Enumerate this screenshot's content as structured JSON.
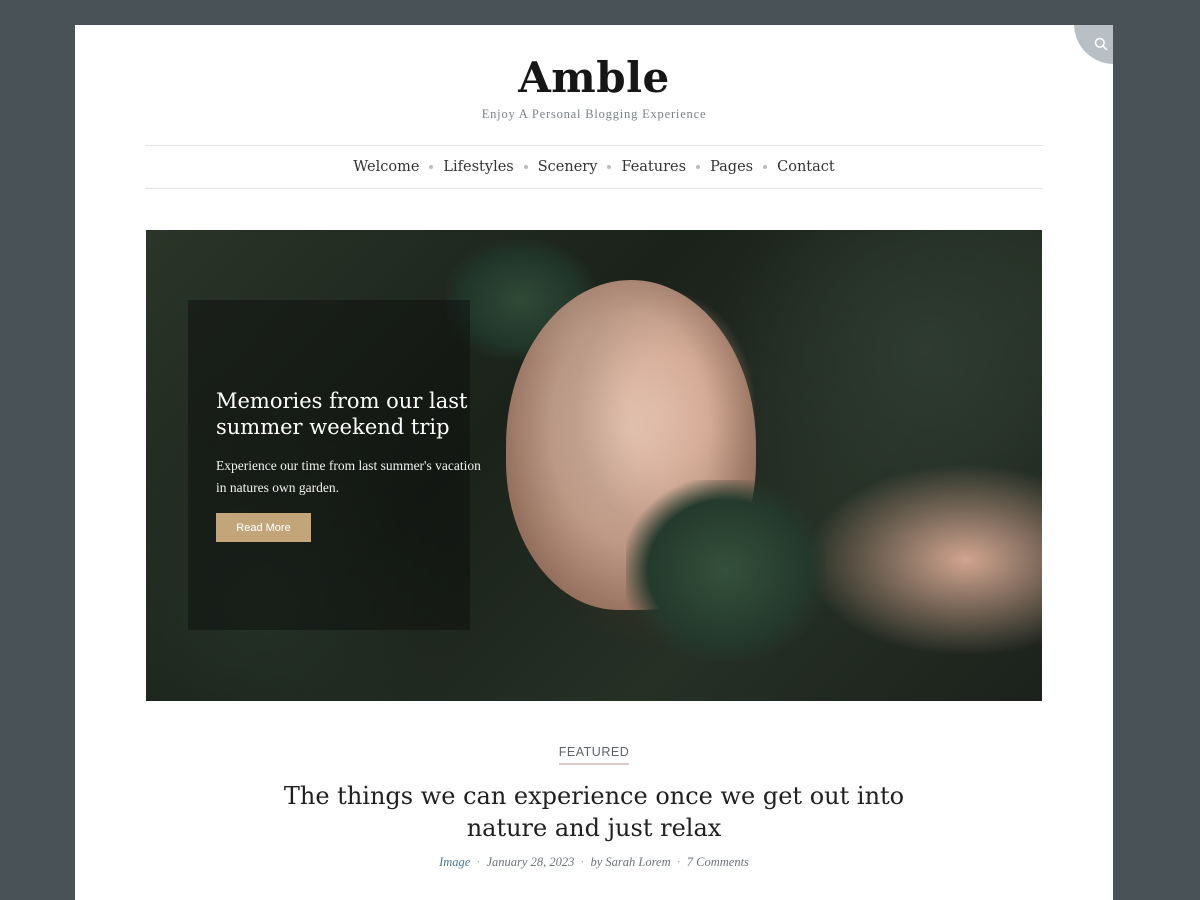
{
  "header": {
    "site_title": "Amble",
    "tagline": "Enjoy A Personal Blogging Experience"
  },
  "search": {
    "icon": "search-icon",
    "color": "#b8c0c6"
  },
  "nav": {
    "items": [
      "Welcome",
      "Lifestyles",
      "Scenery",
      "Features",
      "Pages",
      "Contact"
    ]
  },
  "hero": {
    "title": "Memories from our last summer weekend trip",
    "text": "Experience our time from last summer's vacation in natures own garden.",
    "button_label": "Read More",
    "button_color": "#c2a679"
  },
  "post": {
    "category": "FEATURED",
    "title": "The things we can experience once we get out into nature and just relax",
    "meta": {
      "type": "Image",
      "date": "January 28, 2023",
      "author": "by Sarah Lorem",
      "comments": "7 Comments"
    }
  },
  "colors": {
    "background": "#485257",
    "accent": "#c2a679",
    "link": "#4b7891"
  }
}
